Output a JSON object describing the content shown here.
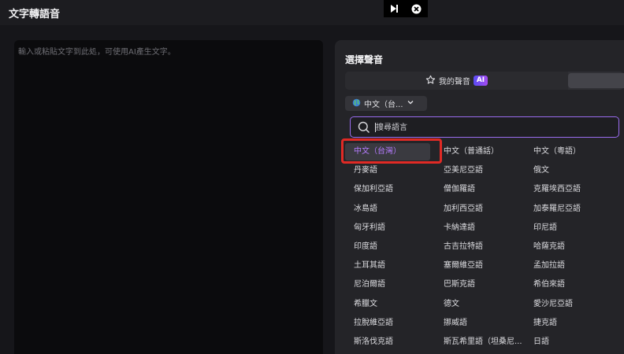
{
  "app": {
    "title": "文字轉語音"
  },
  "player_controls": [
    {
      "icon": "skip-icon"
    },
    {
      "icon": "close-circle-icon"
    }
  ],
  "text_panel": {
    "placeholder": "輸入或粘貼文字到此処，可使用AI產生文字。",
    "value": ""
  },
  "voice_panel": {
    "title": "選擇聲音",
    "tabs": [
      {
        "label": "我的聲音",
        "icon": "star-icon",
        "badge": "AI"
      }
    ],
    "language_dropdown": {
      "selected": "中文（台...",
      "icon": "globe-icon"
    },
    "search": {
      "placeholder": "搜尋語言",
      "value": ""
    },
    "languages": [
      "中文（台灣）",
      "中文（普通話）",
      "中文（粵語）",
      "丹麥語",
      "亞美尼亞語",
      "俄文",
      "保加利亞語",
      "僧伽羅語",
      "克羅埃西亞語",
      "冰島語",
      "加利西亞語",
      "加泰羅尼亞語",
      "匈牙利語",
      "卡納達語",
      "印尼語",
      "印度語",
      "古吉拉特語",
      "哈薩克語",
      "土耳其語",
      "塞爾維亞語",
      "孟加拉語",
      "尼泊爾語",
      "巴斯克語",
      "希伯來語",
      "希臘文",
      "德文",
      "愛沙尼亞語",
      "拉脫維亞語",
      "挪威語",
      "捷克語",
      "斯洛伐克語",
      "斯瓦希里語（坦桑尼...",
      "日語"
    ],
    "selected_language": "中文（台灣）"
  },
  "colors": {
    "accent": "#b57cff",
    "highlight": "#e02a25",
    "search_border": "#9a6cf0"
  }
}
